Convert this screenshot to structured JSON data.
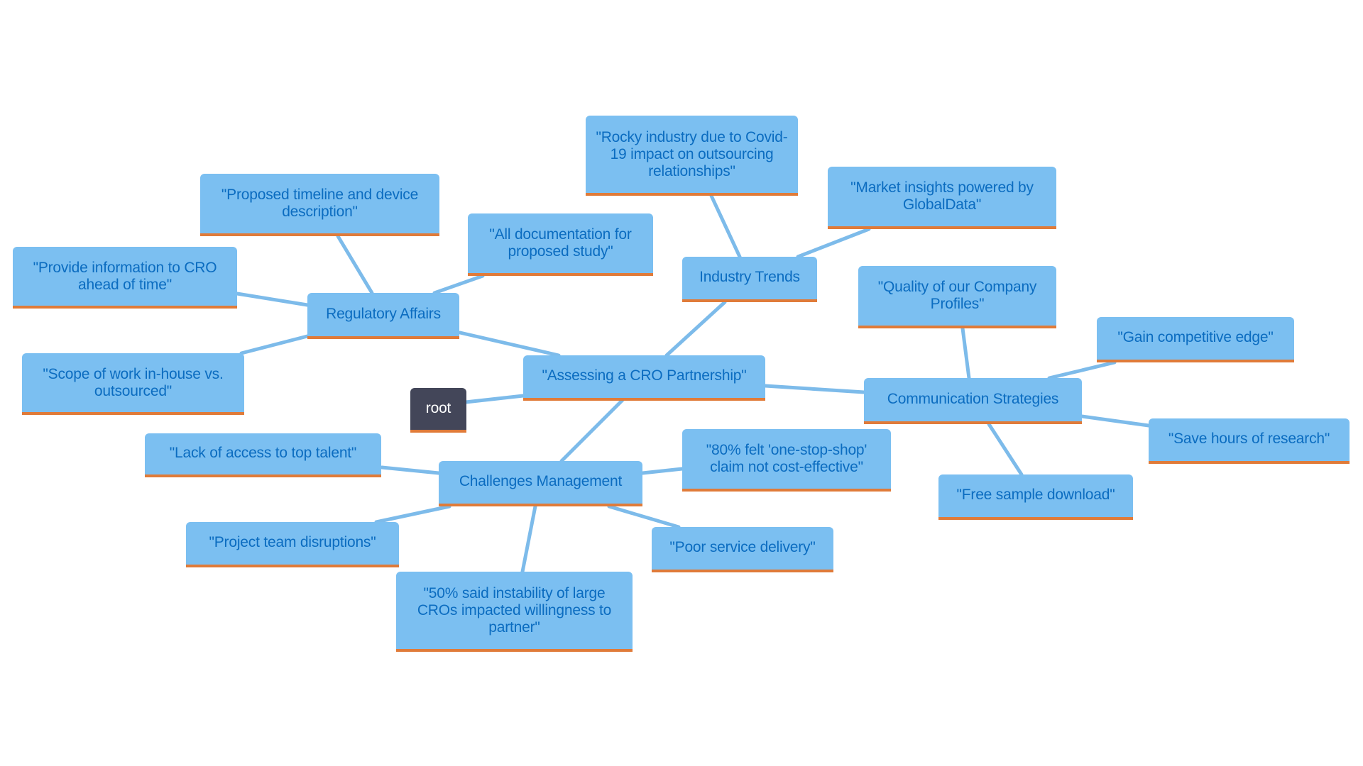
{
  "diagram": {
    "type": "mindmap",
    "colors": {
      "node_fill": "#7bbff1",
      "node_text": "#0b6cc0",
      "node_underline": "#e07b39",
      "root_fill": "#434659",
      "root_text": "#ffffff",
      "edge": "#7dbbea"
    },
    "root": {
      "label": "root"
    },
    "center": {
      "label": "\"Assessing a CRO Partnership\""
    },
    "branches": [
      {
        "label": "Regulatory Affairs",
        "children": [
          "\"Proposed timeline and device description\"",
          "\"All documentation for proposed study\"",
          "\"Provide information to CRO ahead of time\"",
          "\"Scope of work in-house vs. outsourced\""
        ]
      },
      {
        "label": "Industry Trends",
        "children": [
          "\"Rocky industry due to Covid-19 impact on outsourcing relationships\"",
          "\"Market insights powered by GlobalData\""
        ]
      },
      {
        "label": "Communication Strategies",
        "children": [
          "\"Quality of our Company Profiles\"",
          "\"Gain competitive edge\"",
          "\"Save hours of research\"",
          "\"Free sample download\""
        ]
      },
      {
        "label": "Challenges Management",
        "children": [
          "\"Lack of access to top talent\"",
          "\"80% felt 'one-stop-shop' claim not cost-effective\"",
          "\"Project team disruptions\"",
          "\"Poor service delivery\"",
          "\"50% said instability of large CROs impacted willingness to partner\""
        ]
      }
    ]
  }
}
